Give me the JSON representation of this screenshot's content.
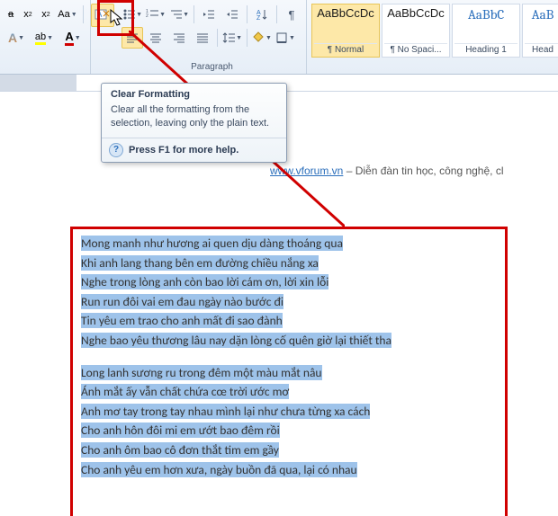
{
  "tooltip": {
    "title": "Clear Formatting",
    "body": "Clear all the formatting from the selection, leaving only the plain text.",
    "footer": "Press F1 for more help."
  },
  "paragraph_group": "Paragraph",
  "styles": [
    {
      "preview": "AaBbCcDc",
      "name": "¶ Normal"
    },
    {
      "preview": "AaBbCcDc",
      "name": "¶ No Spaci..."
    },
    {
      "preview": "AaBbC",
      "name": "Heading 1"
    },
    {
      "preview": "AaB",
      "name": "Head"
    }
  ],
  "link": {
    "url": "www.vforum.vn",
    "text": " – Diễn đàn tin học, công nghệ, cl"
  },
  "lines1": [
    "Mong manh như hương ai quen dịu dàng thoáng qua",
    "Khi anh lang thang bên em đường chiều nắng xa",
    "Nghe trong lòng anh còn bao lời cám ơn, lời xin lỗi",
    "Run run đôi vai em đau ngày nào bước đi",
    "Tin yêu em trao cho anh mất đi sao đành",
    "Nghe bao yêu thương lâu nay dặn lòng cố quên giờ lại thiết tha"
  ],
  "lines2": [
    "Long lanh sương ru trong đêm một màu mắt nâu",
    "Ánh mắt ấy vẫn chất chứa cœ trời ước mơ",
    "Anh mơ tay trong tay nhau mình lại như chưa từng xa cách",
    "Cho anh hôn đôi mi em ướt bao đêm rồi",
    "Cho anh ôm bao cô đơn thắt tim em gầy",
    "Cho anh yêu em hơn xưa, ngày buồn đã qua, lại có nhau"
  ]
}
